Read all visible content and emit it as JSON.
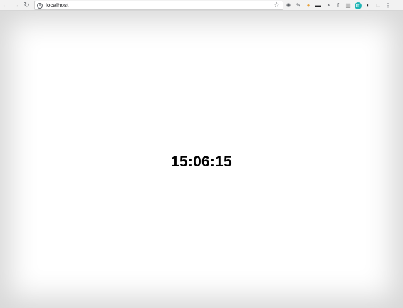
{
  "browser": {
    "url": "localhost",
    "nav": {
      "back_icon": "←",
      "forward_icon": "→",
      "reload_icon": "↻"
    },
    "info_icon": "i",
    "bookmark_icon": "☆",
    "extensions": [
      {
        "name": "gear-extension-icon",
        "glyph": "✺",
        "color": "#5f6368"
      },
      {
        "name": "eyedropper-extension-icon",
        "glyph": "✎",
        "color": "#5f6368"
      },
      {
        "name": "colorful-circle-extension-icon",
        "glyph": "●",
        "color": "#e8a23a"
      },
      {
        "name": "card-extension-icon",
        "glyph": "▬",
        "color": "#202124"
      },
      {
        "name": "clock-extension-icon",
        "glyph": "◔",
        "color": "#5f6368"
      },
      {
        "name": "f-extension-icon",
        "glyph": "f",
        "color": "#5f6368"
      },
      {
        "name": "bar-extension-icon",
        "glyph": "▥",
        "color": "#8a8a8a"
      },
      {
        "name": "m-extension-icon",
        "glyph": "m",
        "color": "#ffffff",
        "bg": "#1fb5b5"
      },
      {
        "name": "dark-circle-extension-icon",
        "glyph": "◐",
        "color": "#202124"
      },
      {
        "name": "square-extension-icon",
        "glyph": "□",
        "color": "#bdbdbd"
      },
      {
        "name": "menu-icon",
        "glyph": "⋮",
        "color": "#5f6368"
      }
    ]
  },
  "page": {
    "time": "15:06:15"
  }
}
